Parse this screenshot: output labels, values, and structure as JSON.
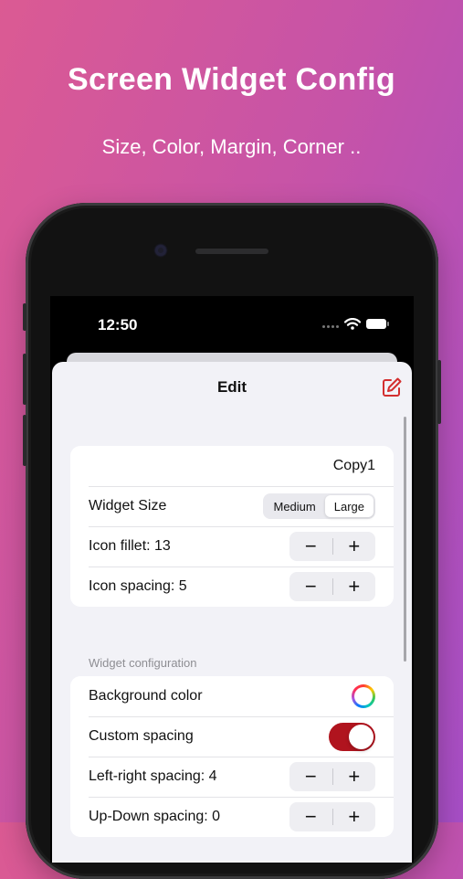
{
  "promo": {
    "title": "Screen Widget Config",
    "subtitle": "Size, Color, Margin, Corner .."
  },
  "status_bar": {
    "time": "12:50"
  },
  "sheet": {
    "title": "Edit",
    "edit_icon": "square-pencil-icon",
    "name_value": "Copy1",
    "widget_size": {
      "label": "Widget Size",
      "options": [
        "Medium",
        "Large"
      ],
      "selected": "Large"
    },
    "icon_fillet_label": "Icon fillet: 13",
    "icon_spacing_label": "Icon spacing: 5",
    "section_header": "Widget configuration",
    "background_color_label": "Background color",
    "custom_spacing_label": "Custom spacing",
    "custom_spacing_on": true,
    "left_right_label": "Left-right spacing: 4",
    "up_down_label": "Up-Down spacing: 0",
    "stepper_minus": "−",
    "stepper_plus": "+"
  },
  "colors": {
    "accent_toggle": "#b0141e",
    "edit_icon": "#d32f2f",
    "background_gradient": [
      "#db5a93",
      "#a64ec6"
    ]
  }
}
